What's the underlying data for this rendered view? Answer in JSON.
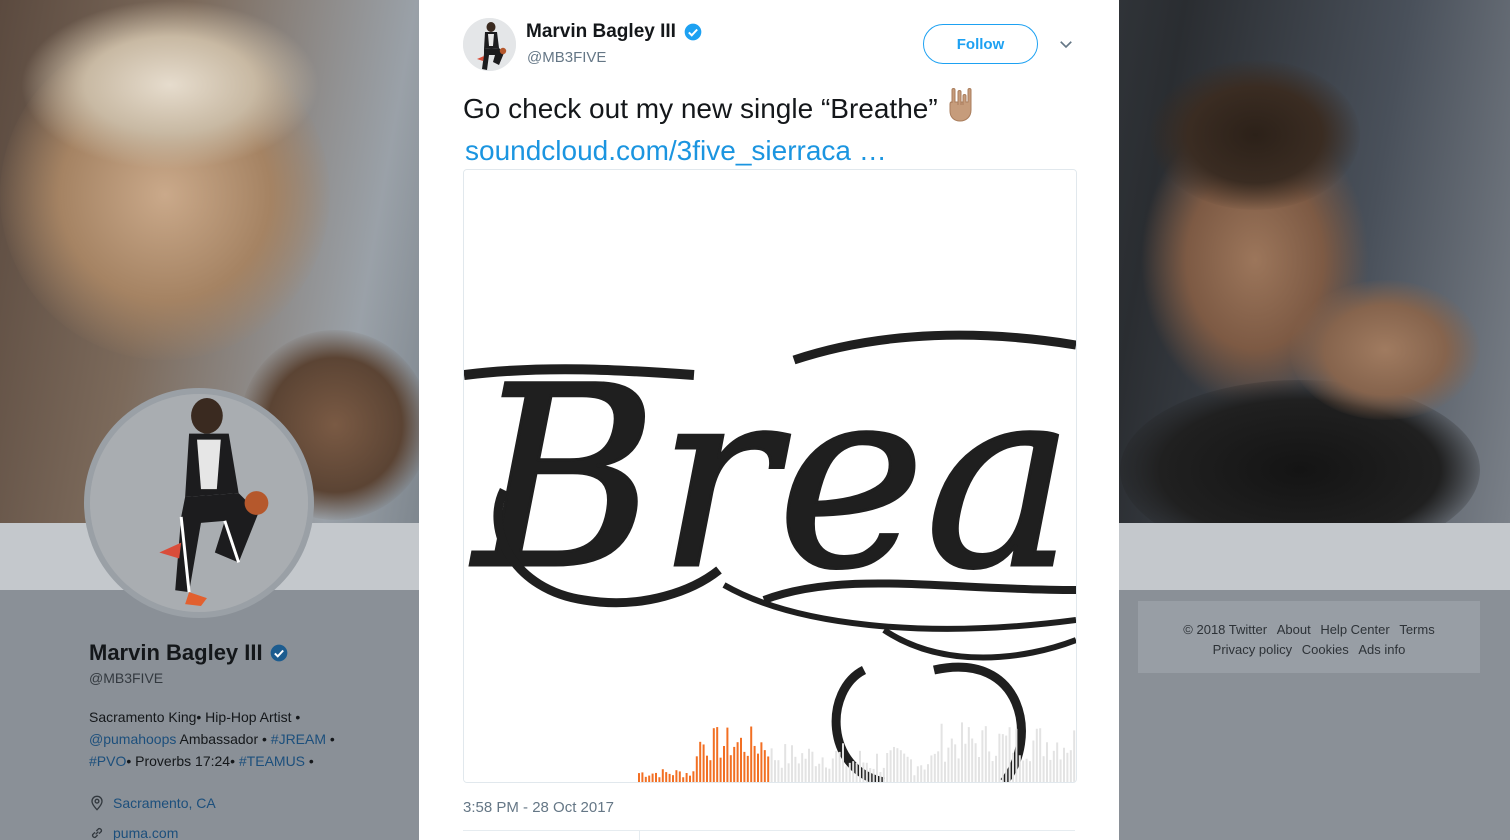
{
  "profile": {
    "name": "Marvin Bagley III",
    "handle": "@MB3FIVE",
    "bio": {
      "line1": "Sacramento King• Hip-Hop Artist •",
      "mention": "@pumahoops",
      "line2_text": " Ambassador • ",
      "hashtag1": "#JREAM",
      "line2_tail": " •",
      "hashtag2": "#PVO",
      "line3_text": "• Proverbs 17:24• ",
      "hashtag3": "#TEAMUS",
      "line3_tail": " •"
    },
    "location": "Sacramento, CA",
    "website": "puma.com",
    "icons": {
      "location": "location-pin-icon",
      "website": "link-icon",
      "verified": "verified-badge-icon"
    }
  },
  "footer": {
    "copyright": "© 2018 Twitter",
    "about": "About",
    "help": "Help Center",
    "terms": "Terms",
    "privacy": "Privacy policy",
    "cookies": "Cookies",
    "ads": "Ads info"
  },
  "tweet": {
    "author_name": "Marvin Bagley III",
    "author_handle": "@MB3FIVE",
    "follow_label": "Follow",
    "text": "Go check out my new single “Breathe”",
    "emoji": "🤘🏽",
    "link_text": "soundcloud.com/3five_sierraca …",
    "card_artwork_text": "Breathe",
    "timestamp": "3:58 PM - 28 Oct 2017",
    "colors": {
      "link": "#1b95e0",
      "accent": "#1da1f2",
      "waveform_played": "#f26f23",
      "waveform_unplayed": "#e3e3e3"
    }
  }
}
